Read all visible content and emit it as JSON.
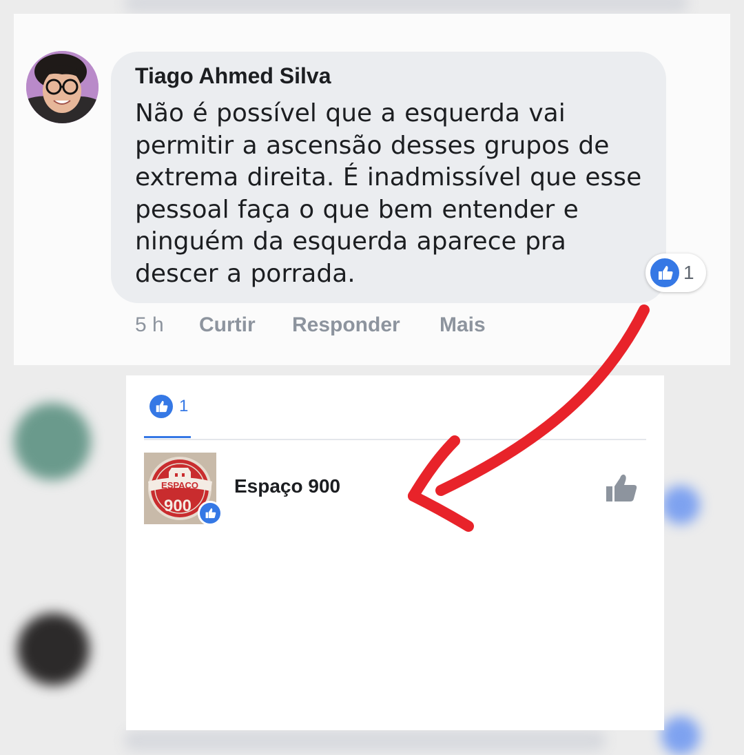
{
  "comment": {
    "author": "Tiago Ahmed Silva",
    "text": "Não é possível que a esquerda vai permitir a ascensão desses grupos de extrema direita. É inadmissível que esse pessoal faça o que bem entender e ninguém da esquerda aparece pra descer a porrada.",
    "reaction_count": "1",
    "actions": {
      "time": "5 h",
      "like": "Curtir",
      "reply": "Responder",
      "more": "Mais"
    }
  },
  "reactions_panel": {
    "tab_count": "1",
    "reactor": {
      "name": "Espaço 900",
      "logo_top": "ESPAÇO",
      "logo_bottom": "900"
    }
  },
  "colors": {
    "accent": "#3578e5",
    "annotation_arrow": "#e8232a",
    "bubble": "#ebedf0",
    "muted_text": "#8d949e"
  }
}
